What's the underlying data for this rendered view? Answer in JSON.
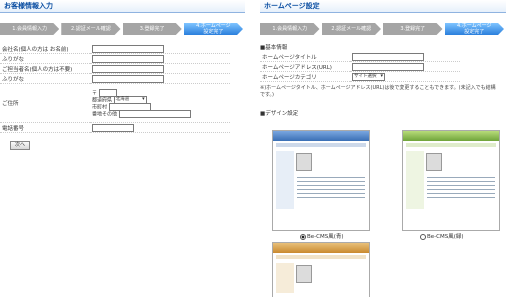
{
  "left": {
    "title": "お客様情報入力",
    "steps": [
      "1.会員情報入力",
      "2.認証メール確認",
      "3.登録完了",
      "4.ホームページ\n設定完了"
    ],
    "fields": {
      "company_label": "会社名(個人の方は お名前)",
      "furigana1_label": "ふりがな",
      "contact_label": "ご担当者名(個人の方は不要)",
      "furigana2_label": "ふりがな",
      "address_label": "ご住所",
      "postal_prefix": "〒",
      "prefecture_label": "都道府県",
      "prefecture_value": "北海道",
      "city_label": "市町村",
      "street_label": "番地その他",
      "phone_label": "電話番号"
    },
    "next_button": "次へ"
  },
  "right": {
    "title": "ホームページ設定",
    "steps": [
      "1.会員情報入力",
      "2.認証メール確認",
      "3.登録完了",
      "4.ホームページ\n設定完了"
    ],
    "basic_heading": "■基本情報",
    "site_title_label": "ホームページタイトル",
    "site_url_label": "ホームページアドレス(URL)",
    "site_category_label": "ホームページカテゴリ",
    "site_category_value": "サイト選択",
    "note": "※)ホームページタイトル、ホームページアドレス(URL)は後で変更することもできます。(未記入でも結構です。)",
    "design_heading": "■デザイン設定",
    "designs": [
      {
        "caption": "Be-CMS風(青)",
        "selected": true
      },
      {
        "caption": "Be-CMS風(緑)",
        "selected": false
      },
      {
        "caption": "",
        "selected": false
      }
    ]
  },
  "colors": {
    "title_blue": "#0b4ea2",
    "step_gray": "#a5a5a5",
    "step_active": "#2a7fdc",
    "thumb_blue": "#3a6fb5",
    "thumb_green": "#6fa43a",
    "thumb_orange": "#c98a2f"
  }
}
